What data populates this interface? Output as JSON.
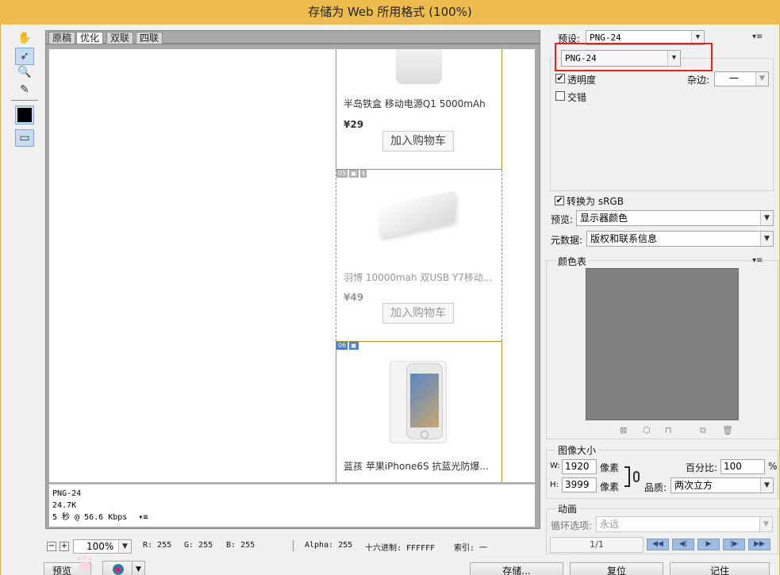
{
  "window": {
    "title": "存储为 Web 所用格式 (100%)"
  },
  "tabs": [
    "原稿",
    "优化",
    "双联",
    "四联"
  ],
  "preview": {
    "products": [
      {
        "name": "半岛铁盒 移动电源Q1 5000mAh",
        "price": "¥29",
        "cart": "加入购物车"
      },
      {
        "name": "羽博 10000mah 双USB Y7移动...",
        "price": "¥49",
        "cart": "加入购物车"
      },
      {
        "name": "蓝孩 苹果iPhone6S 抗蓝光防爆...",
        "price": "",
        "cart": ""
      }
    ],
    "slice_badges": [
      "05",
      "06"
    ]
  },
  "info": {
    "format": "PNG-24",
    "size": "24.7K",
    "speed": "5 秒 @ 56.6 Kbps"
  },
  "status": {
    "zoom": "100%",
    "r": "R: 255",
    "g": "G: 255",
    "b": "B: 255",
    "alpha": "Alpha: 255",
    "hex": "十六进制: FFFFFF",
    "index": "索引: 一"
  },
  "bottom_buttons": {
    "preview": "预览",
    "save": "存储...",
    "reset": "复位",
    "remember": "记住"
  },
  "settings": {
    "preset_label": "预设:",
    "preset_value": "PNG-24",
    "format_value": "PNG-24",
    "transparency": "透明度",
    "interlaced": "交错",
    "matte_label": "杂边:",
    "matte_value": "一",
    "convert_srgb": "转换为 sRGB",
    "preview_label": "预览:",
    "preview_value": "显示器颜色",
    "metadata_label": "元数据:",
    "metadata_value": "版权和联系信息"
  },
  "color_table": {
    "title": "颜色表",
    "fill": "#808080"
  },
  "image_size": {
    "title": "图像大小",
    "w_label": "W:",
    "w_value": "1920",
    "w_unit": "像素",
    "h_label": "H:",
    "h_value": "3999",
    "h_unit": "像素",
    "percent_label": "百分比:",
    "percent_value": "100",
    "percent_unit": "%",
    "quality_label": "品质:",
    "quality_value": "两次立方"
  },
  "animation": {
    "title": "动画",
    "loop_label": "循环选项:",
    "loop_value": "永远",
    "frame": "1/1"
  },
  "colors": {
    "titlebar": "#eebb4f",
    "highlight": "#e52222",
    "slice": "#b9952c"
  }
}
